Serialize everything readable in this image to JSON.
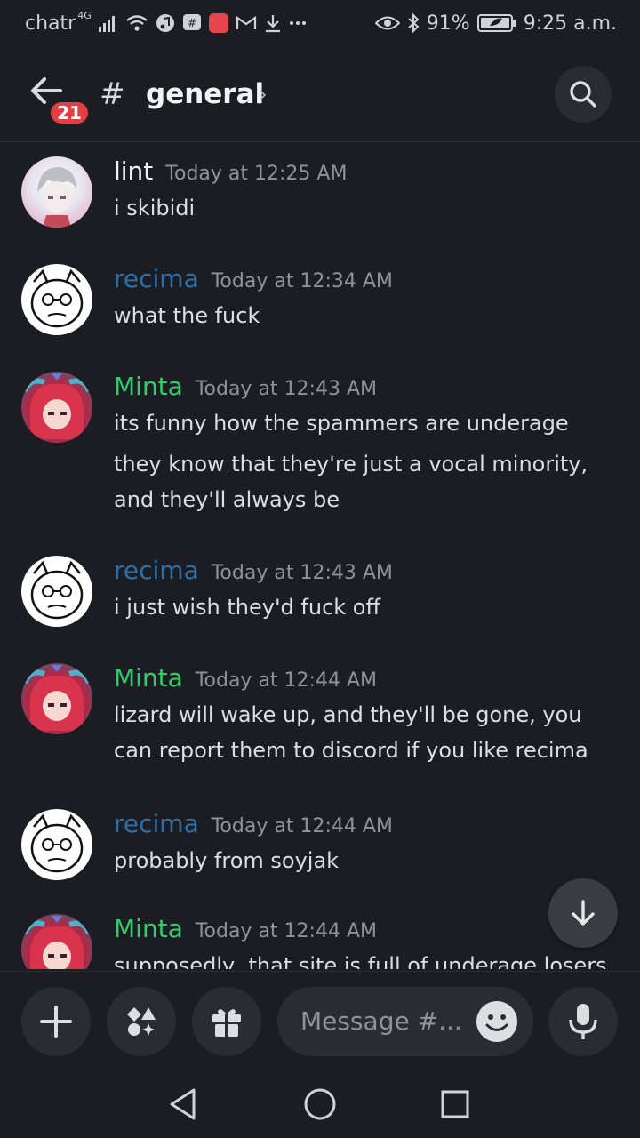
{
  "status_bar": {
    "carrier": "chatr",
    "network": "4G",
    "battery": "91%",
    "time": "9:25 a.m."
  },
  "header": {
    "unread_count": "21",
    "hash": "#",
    "channel": "general",
    "chevron": "›"
  },
  "messages": [
    {
      "user": "lint",
      "user_color": "#f2f3f5",
      "time": "Today at 12:25 AM",
      "avatar": "lint",
      "lines": [
        "i skibidi"
      ]
    },
    {
      "user": "recima",
      "user_color": "#2f6fa8",
      "time": "Today at 12:34 AM",
      "avatar": "recima",
      "lines": [
        "what the fuck"
      ]
    },
    {
      "user": "Minta",
      "user_color": "#2fce6d",
      "time": "Today at 12:43 AM",
      "avatar": "minta",
      "lines": [
        "its funny how the spammers are underage",
        "they know that they're just a vocal minority, and they'll always be"
      ]
    },
    {
      "user": "recima",
      "user_color": "#2f6fa8",
      "time": "Today at 12:43 AM",
      "avatar": "recima",
      "lines": [
        "i just wish they'd fuck off"
      ]
    },
    {
      "user": "Minta",
      "user_color": "#2fce6d",
      "time": "Today at 12:44 AM",
      "avatar": "minta",
      "lines": [
        "lizard will wake up, and they'll be gone, you can report them to discord if you like recima"
      ]
    },
    {
      "user": "recima",
      "user_color": "#2f6fa8",
      "time": "Today at 12:44 AM",
      "avatar": "recima",
      "lines": [
        "probably from soyjak"
      ]
    },
    {
      "user": "Minta",
      "user_color": "#2fce6d",
      "time": "Today at 12:44 AM",
      "avatar": "minta",
      "lines": [
        "supposedly, that site is full of underage losers"
      ]
    }
  ],
  "composer": {
    "placeholder": "Message #..."
  },
  "icons": {
    "back": "arrow-left-icon",
    "search": "search-icon",
    "scroll_down": "arrow-down-icon",
    "add": "plus-icon",
    "apps": "apps-icon",
    "gift": "gift-icon",
    "emoji": "emoji-icon",
    "mic": "microphone-icon"
  }
}
